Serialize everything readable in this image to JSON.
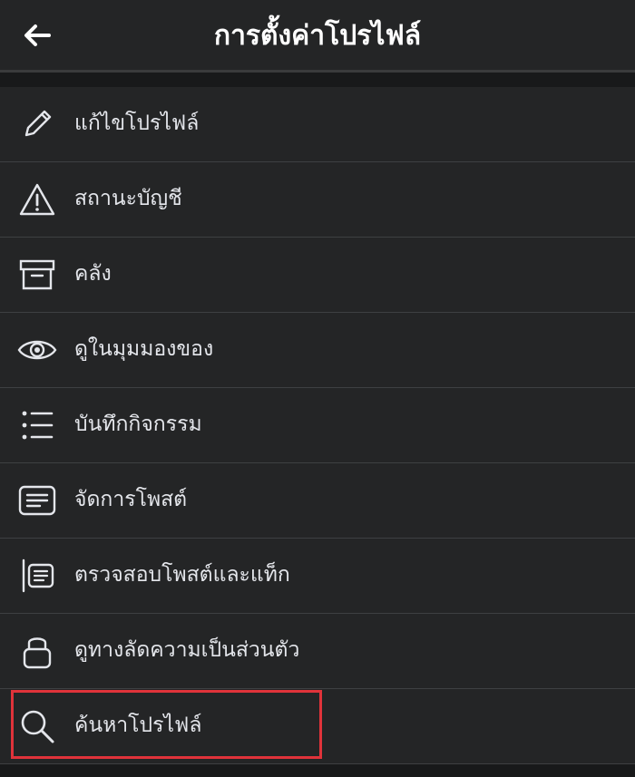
{
  "header": {
    "title": "การตั้งค่าโปรไฟล์",
    "back_icon": "arrow-left-icon"
  },
  "menu": {
    "items": [
      {
        "label": "แก้ไขโปรไฟล์",
        "icon": "pencil-icon"
      },
      {
        "label": "สถานะบัญชี",
        "icon": "warning-triangle-icon"
      },
      {
        "label": "คลัง",
        "icon": "archive-box-icon"
      },
      {
        "label": "ดูในมุมมองของ",
        "icon": "eye-icon"
      },
      {
        "label": "บันทึกกิจกรรม",
        "icon": "list-icon"
      },
      {
        "label": "จัดการโพสต์",
        "icon": "post-lines-icon"
      },
      {
        "label": "ตรวจสอบโพสต์และแท็ก",
        "icon": "review-posts-icon"
      },
      {
        "label": "ดูทางลัดความเป็นส่วนตัว",
        "icon": "lock-icon"
      },
      {
        "label": "ค้นหาโปรไฟล์",
        "icon": "search-icon"
      }
    ]
  },
  "colors": {
    "background": "#242526",
    "text": "#e4e6eb",
    "divider": "#3e4042",
    "highlight": "#e0333a"
  }
}
